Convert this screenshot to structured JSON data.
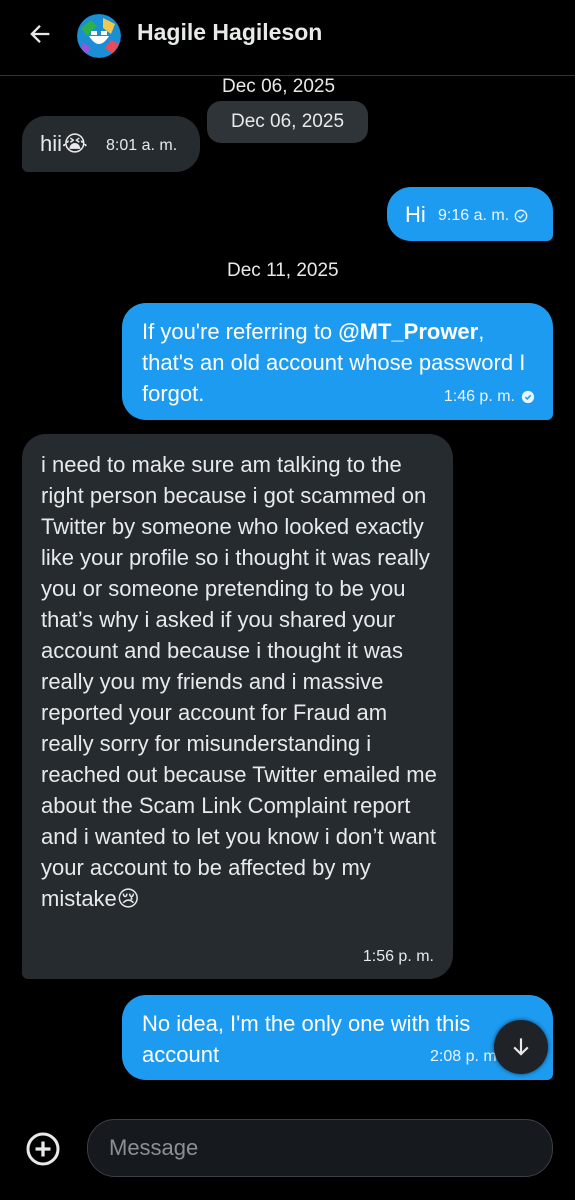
{
  "header": {
    "back_icon": "arrow-left-icon",
    "contact_name": "Hagile Hagileson"
  },
  "dates": {
    "first_sticky": "Dec 06, 2025",
    "first_pill": "Dec 06, 2025",
    "second": "Dec 11, 2025"
  },
  "messages": [
    {
      "direction": "incoming",
      "text": "hii😭",
      "time": "8:01 a. m."
    },
    {
      "direction": "outgoing",
      "text": "Hi",
      "time": "9:16 a. m.",
      "status": "sent"
    },
    {
      "direction": "outgoing",
      "text_before": "If you're referring to ",
      "mention": "@MT_Prower",
      "text_after": ", that's an old account whose password I forgot.",
      "time": "1:46 p. m.",
      "status": "read"
    },
    {
      "direction": "incoming",
      "text": "i need to make sure am talking to the right person because i got scammed on Twitter by someone who looked exactly like your profile so i thought it was really you or someone pretending to be you that’s why i asked if you shared your account and because i thought it was really you my friends and i massive reported your account for Fraud am really sorry for misunderstanding i reached out because Twitter emailed me about the Scam Link Complaint report and i wanted to let you know i don’t want your account to be affected by my mistake😢",
      "time": "1:56 p. m."
    },
    {
      "direction": "outgoing",
      "text": "No idea, I'm the only one with this account",
      "time": "2:08 p. m."
    }
  ],
  "composer": {
    "placeholder": "Message",
    "add_icon": "plus-circle-icon"
  },
  "scroll_button_icon": "arrow-down-icon",
  "colors": {
    "background": "#000000",
    "incoming_bubble": "#262b30",
    "outgoing_bubble": "#1d9bf0",
    "text": "#e7e9ea"
  }
}
